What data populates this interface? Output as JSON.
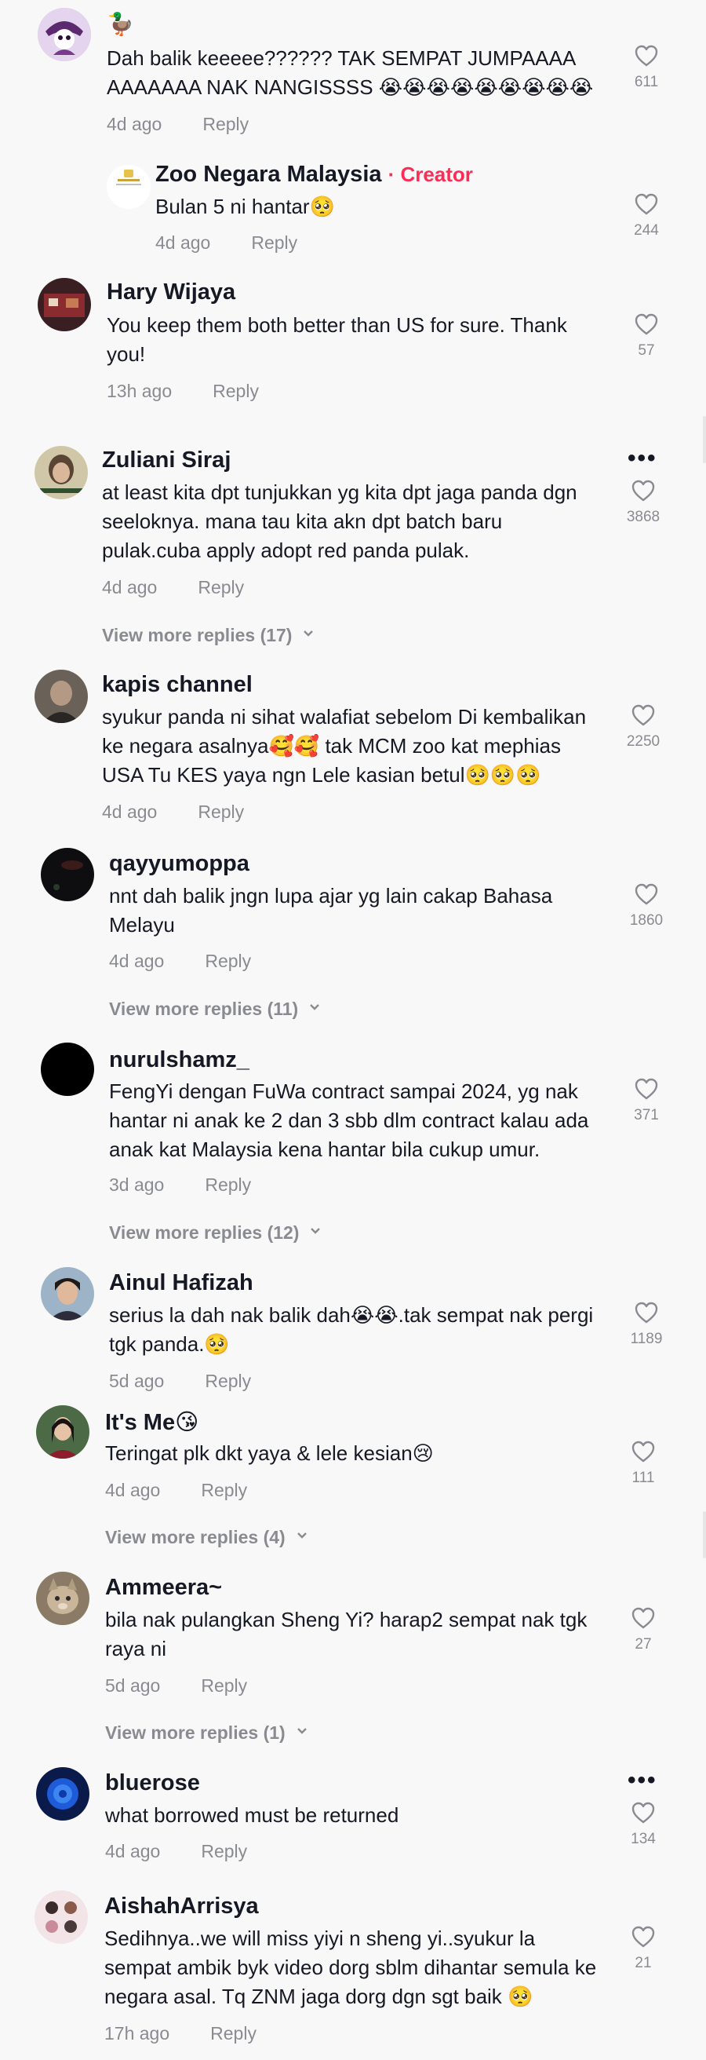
{
  "comments": [
    {
      "name": "",
      "text": "Dah balik keeeee?????? TAK SEMPAT JUMPAAAA AAAAAAA NAK NANGISSSS 😭😭😭😭😭😭😭😭😭",
      "time": "4d ago",
      "reply": "Reply",
      "likes": "611"
    },
    {
      "name": "Zoo Negara Malaysia",
      "creator_label": "· Creator",
      "text": "Bulan 5 ni hantar🥺",
      "time": "4d ago",
      "reply": "Reply",
      "likes": "244"
    },
    {
      "name": "Hary Wijaya",
      "text": "You keep them both better than US for sure. Thank you!",
      "time": "13h ago",
      "reply": "Reply",
      "likes": "57"
    },
    {
      "name": "Zuliani Siraj",
      "text": "at least kita dpt tunjukkan yg kita dpt jaga panda dgn seeloknya. mana tau kita akn dpt batch baru pulak.cuba apply adopt red panda pulak.",
      "time": "4d ago",
      "reply": "Reply",
      "likes": "3868",
      "more": "View more replies (17)"
    },
    {
      "name": "kapis channel",
      "text": "syukur panda ni sihat walafiat sebelom Di kembalikan ke negara asalnya🥰🥰 tak MCM zoo kat mephias USA Tu KES yaya ngn Lele kasian betul🥺🥺🥺",
      "time": "4d ago",
      "reply": "Reply",
      "likes": "2250"
    },
    {
      "name": "qayyumoppa",
      "text": "nnt dah balik jngn lupa ajar yg lain cakap Bahasa Melayu",
      "time": "4d ago",
      "reply": "Reply",
      "likes": "1860",
      "more": "View more replies (11)"
    },
    {
      "name": "nurulshamz_",
      "text": "FengYi dengan FuWa contract sampai 2024, yg nak hantar ni anak ke 2 dan 3 sbb dlm contract kalau ada anak kat Malaysia kena hantar bila cukup umur.",
      "time": "3d ago",
      "reply": "Reply",
      "likes": "371",
      "more": "View more replies (12)"
    },
    {
      "name": "Ainul Hafizah",
      "text": "serius la dah nak balik dah😭😭.tak sempat nak pergi tgk panda.🥺",
      "time": "5d ago",
      "reply": "Reply",
      "likes": "1189"
    },
    {
      "name": "It's Me😘",
      "text": "Teringat plk dkt yaya & lele kesian😢",
      "time": "4d ago",
      "reply": "Reply",
      "likes": "111",
      "more": "View more replies (4)"
    },
    {
      "name": "Ammeera~",
      "text": "bila nak pulangkan Sheng Yi? harap2 sempat nak tgk raya ni",
      "time": "5d ago",
      "reply": "Reply",
      "likes": "27",
      "more": "View more replies (1)"
    },
    {
      "name": "bluerose",
      "text": "what borrowed must be returned",
      "time": "4d ago",
      "reply": "Reply",
      "likes": "134"
    },
    {
      "name": "AishahArrisya",
      "text": "Sedihnya..we will miss yiyi n sheng yi..syukur la sempat ambik byk video dorg sblm dihantar semula ke negara asal. Tq ZNM jaga dorg dgn sgt baik 🥺",
      "time": "17h ago",
      "reply": "Reply",
      "likes": "21"
    }
  ],
  "icons": {
    "like": "heart-outline-icon",
    "more": "chevron-down-icon",
    "options": "more-options-icon"
  },
  "colors": {
    "creator": "#fe2c55",
    "meta": "#8a8b91",
    "background": "#f8f8f8"
  }
}
